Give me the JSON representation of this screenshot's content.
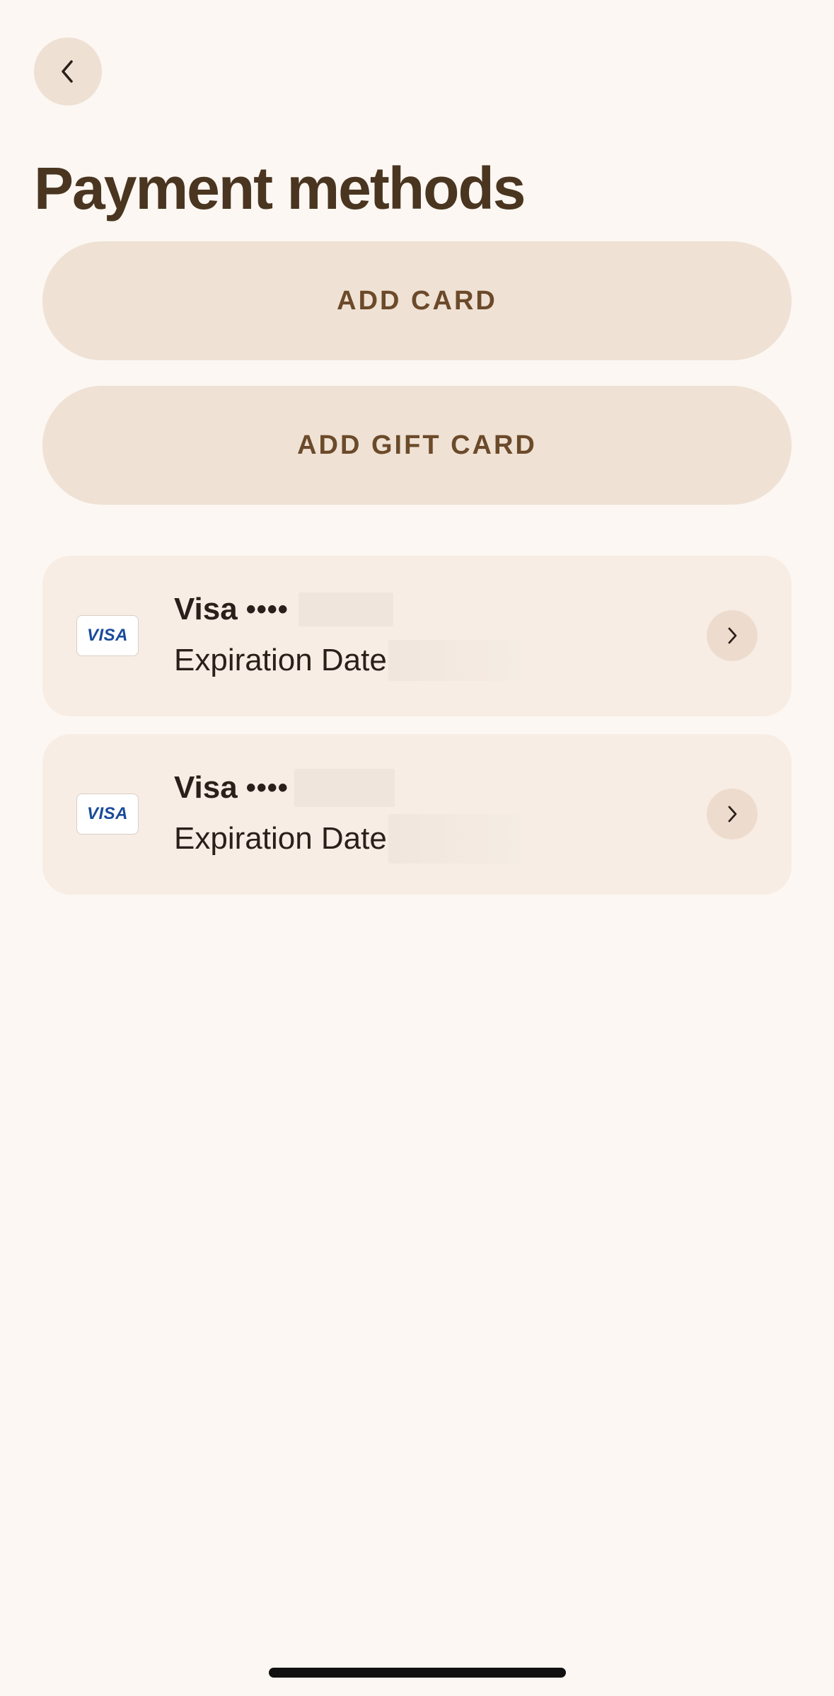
{
  "header": {
    "back_icon": "chevron-left-icon",
    "title": "Payment methods"
  },
  "actions": {
    "add_card_label": "ADD CARD",
    "add_gift_card_label": "ADD GIFT CARD"
  },
  "cards": [
    {
      "brand": "Visa",
      "masked": "••••",
      "expiration_label": "Expiration Date",
      "logo_text": "VISA",
      "chevron_icon": "chevron-right-icon"
    },
    {
      "brand": "Visa",
      "masked": "••••",
      "expiration_label": "Expiration Date",
      "logo_text": "VISA",
      "chevron_icon": "chevron-right-icon"
    }
  ],
  "colors": {
    "background": "#fcf7f2",
    "button_bg": "#efe1d4",
    "button_text": "#6b4a2a",
    "title_text": "#4a3520",
    "card_bg": "#f8ede4",
    "visa_blue": "#1a4b9c"
  }
}
